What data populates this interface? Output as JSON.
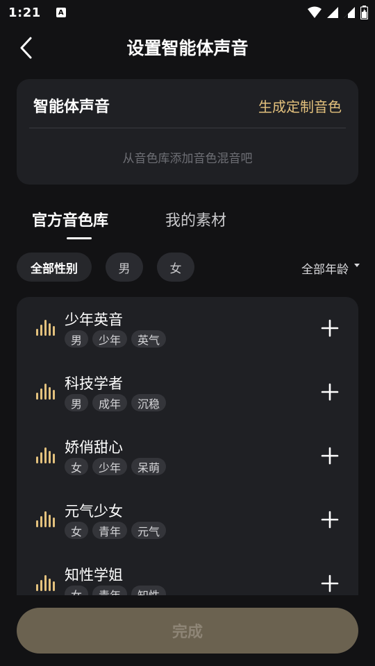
{
  "status_bar": {
    "time": "1:21",
    "notification_glyph": "A",
    "icons": [
      "wifi-icon",
      "signal-icon",
      "signal-icon",
      "battery-icon"
    ]
  },
  "header": {
    "title": "设置智能体声音",
    "back_icon": "chevron-left-icon"
  },
  "voice_card": {
    "title": "智能体声音",
    "generate_link": "生成定制音色",
    "hint": "从音色库添加音色混音吧"
  },
  "tabs": [
    {
      "label": "官方音色库",
      "active": true
    },
    {
      "label": "我的素材",
      "active": false
    }
  ],
  "filters": {
    "chips": [
      "全部性别",
      "男",
      "女"
    ],
    "age": "全部年龄"
  },
  "voices": [
    {
      "name": "少年英音",
      "tags": [
        "男",
        "少年",
        "英气"
      ]
    },
    {
      "name": "科技学者",
      "tags": [
        "男",
        "成年",
        "沉稳"
      ]
    },
    {
      "name": "娇俏甜心",
      "tags": [
        "女",
        "少年",
        "呆萌"
      ]
    },
    {
      "name": "元气少女",
      "tags": [
        "女",
        "青年",
        "元气"
      ]
    },
    {
      "name": "知性学姐",
      "tags": [
        "女",
        "青年",
        "知性"
      ]
    }
  ],
  "done_button": "完成",
  "colors": {
    "accent": "#e3c17d",
    "background": "#121214",
    "card": "#1f2024",
    "done_button": "#6b6250"
  }
}
